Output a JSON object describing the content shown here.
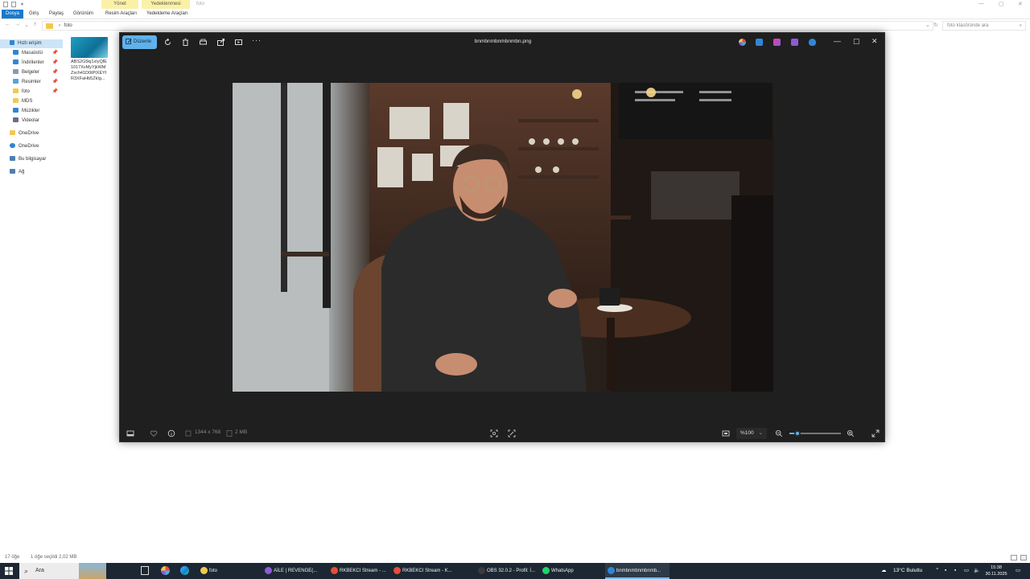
{
  "explorer": {
    "context_tabs": {
      "manage": "Yönet",
      "backup": "Yedeklenmesi",
      "title": "foto"
    },
    "ribbon_tabs": [
      "Dosya",
      "Giriş",
      "Paylaş",
      "Görünüm",
      "Resim Araçları",
      "Yedekleme Araçları"
    ],
    "address": {
      "separator": "›",
      "folder": "foto"
    },
    "search_placeholder": "foto klasöründe ara",
    "nav": {
      "quick_access": "Hızlı erişim",
      "items": [
        "Masaüstü",
        "İndirilenler",
        "Belgeler",
        "Resimler",
        "foto",
        "MDS",
        "Müzikler",
        "Videolar"
      ],
      "onedrive_personal": "OneDrive",
      "onedrive": "OneDrive",
      "this_pc": "Bu bilgisayar",
      "network": "Ağ"
    },
    "file": {
      "name": "ABS2G5kj1xIyQfE\n1017XvMyYjkWM\nZsch41D0tPIXEYI\nR3XFaHb5ZkIg..."
    },
    "status": {
      "count": "17 öğe",
      "selected": "1 öğe seçildi  2,02 MB"
    }
  },
  "photos": {
    "edit_label": "Düzenle",
    "title": "bnmbnmbnmbnmbn.png",
    "dimensions": "1344 x 768",
    "size": "2 MB",
    "zoom": "%100",
    "zoom_level": 0.15
  },
  "taskbar": {
    "search": "Ara",
    "apps": [
      {
        "label": "foto",
        "color": "#f3c94d"
      },
      {
        "label": "AİLE | REVENGE(...",
        "color": "#8e5bd6"
      },
      {
        "label": "RKBEKCI Stream - ...",
        "color": "#e34f3b"
      },
      {
        "label": "RKBEKCI Stream - K...",
        "color": "#e34f3b"
      },
      {
        "label": "OBS 32.0.2 - Profil: İ...",
        "color": "#3b3b3b"
      },
      {
        "label": "WhatsApp",
        "color": "#25d366"
      },
      {
        "label": "bnmbnmbnmbnmb...",
        "color": "#2f86d6"
      }
    ],
    "weather": "13°C  Bulutlu",
    "time": "15:38",
    "date": "30.11.2025"
  }
}
